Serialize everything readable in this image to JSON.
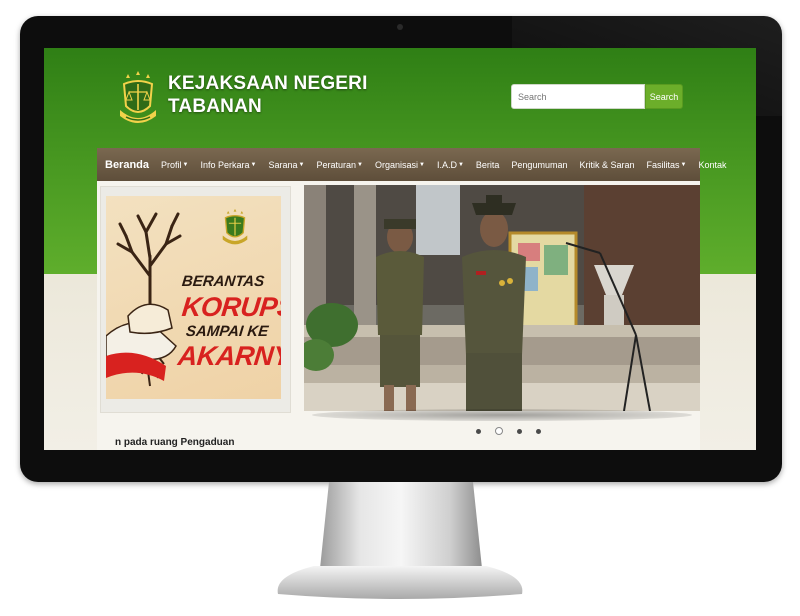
{
  "site": {
    "title_line1": "KEJAKSAAN NEGERI",
    "title_line2": "TABANAN"
  },
  "search": {
    "placeholder": "Search",
    "button_label": "Search"
  },
  "nav": {
    "items": [
      {
        "label": "Beranda",
        "dropdown": false,
        "active": true
      },
      {
        "label": "Profil",
        "dropdown": true
      },
      {
        "label": "Info Perkara",
        "dropdown": true
      },
      {
        "label": "Sarana",
        "dropdown": true
      },
      {
        "label": "Peraturan",
        "dropdown": true
      },
      {
        "label": "Organisasi",
        "dropdown": true
      },
      {
        "label": "I.A.D",
        "dropdown": true
      },
      {
        "label": "Berita",
        "dropdown": false
      },
      {
        "label": "Pengumuman",
        "dropdown": false
      },
      {
        "label": "Kritik & Saran",
        "dropdown": false
      },
      {
        "label": "Fasilitas",
        "dropdown": true
      },
      {
        "label": "Kontak",
        "dropdown": false
      }
    ]
  },
  "poster": {
    "line1": "BERANTAS",
    "line2": "KORUPSI",
    "line3": "SAMPAI KE",
    "line4": "AKARNYA"
  },
  "slider": {
    "dot_count": 4,
    "active_index": 1
  },
  "ticker": {
    "text": "n pada ruang Pengaduan"
  },
  "colors": {
    "header_green": "#4a9a22",
    "nav_brown": "#6b5a44",
    "search_button": "#6cae2a",
    "poster_red": "#d8221f"
  }
}
